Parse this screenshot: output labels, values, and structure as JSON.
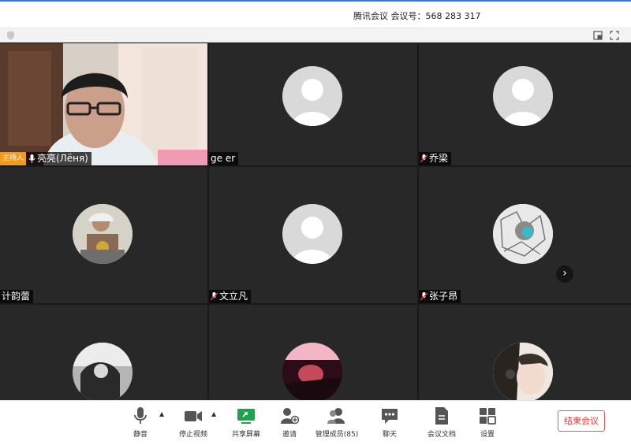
{
  "title": "腾讯会议  会议号：568 283 317",
  "participants": [
    {
      "name": "亮亮(Лёня)",
      "host_badge": "主持人",
      "mic": "on",
      "video": "camera"
    },
    {
      "name": "ge er",
      "mic": "none",
      "video": "default-avatar"
    },
    {
      "name": "乔梁",
      "mic": "muted",
      "video": "default-avatar"
    },
    {
      "name": "计韵蕾",
      "mic": "none",
      "video": "photo-avatar"
    },
    {
      "name": "文立凡",
      "mic": "muted",
      "video": "default-avatar"
    },
    {
      "name": "张子昂",
      "mic": "muted",
      "video": "photo-avatar"
    },
    {
      "name": "",
      "video": "photo-avatar"
    },
    {
      "name": "",
      "video": "photo-avatar"
    },
    {
      "name": "",
      "video": "photo-avatar"
    }
  ],
  "controls": {
    "mute": "静音",
    "stop_video": "停止视频",
    "share_screen": "共享屏幕",
    "invite": "邀请",
    "manage_members": "管理成员(85)",
    "chat": "聊天",
    "meeting_docs": "会议文档",
    "settings": "设置",
    "end_meeting": "结束会议"
  },
  "colors": {
    "accent": "#2f7be6",
    "host_badge": "#f29a1a",
    "share_green": "#1fa34a",
    "end_red": "#e04040",
    "tile_bg": "#282828"
  }
}
